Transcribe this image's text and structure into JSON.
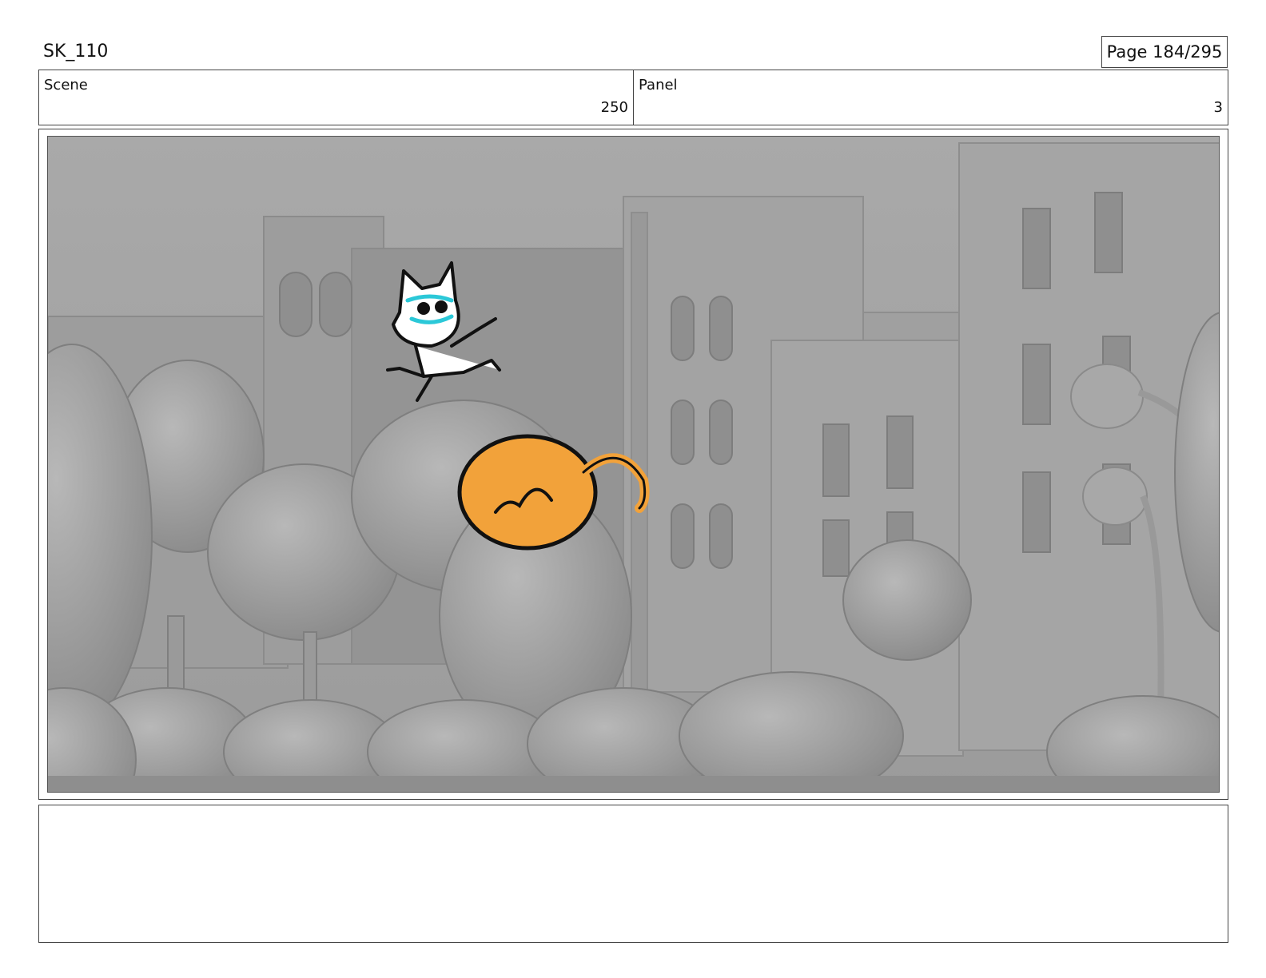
{
  "header": {
    "doc_title": "SK_110",
    "page_label": "Page 184/295"
  },
  "info": {
    "scene_label": "Scene",
    "scene_value": "250",
    "panel_label": "Panel",
    "panel_value": "3"
  },
  "frame": {
    "description_icon": "storyboard-render-illustration"
  },
  "notes": {
    "text": ""
  }
}
